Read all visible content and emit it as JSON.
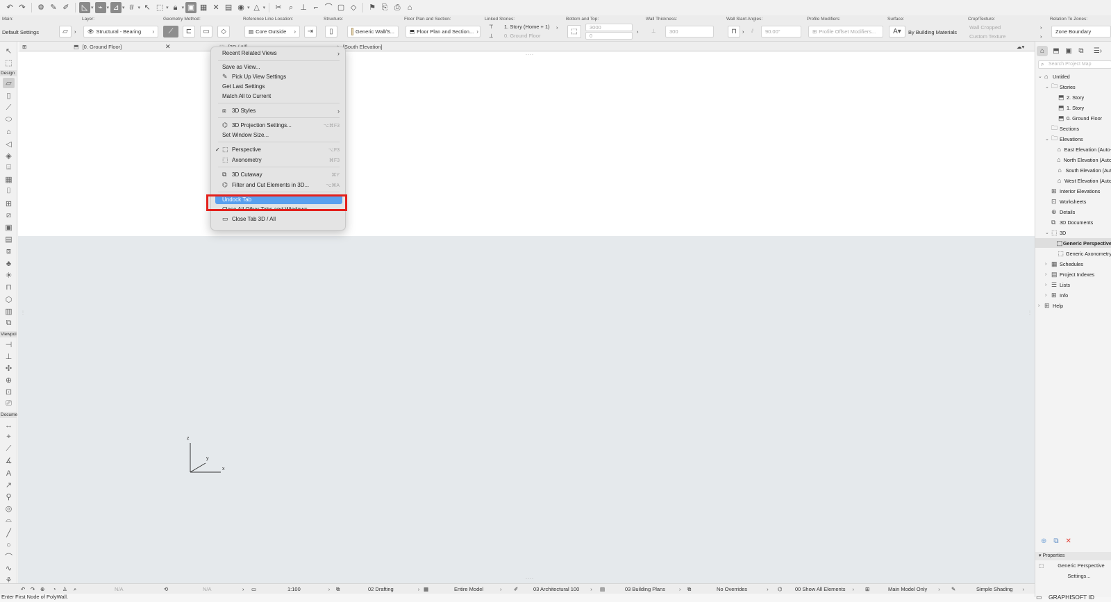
{
  "toolbar": {
    "icons": [
      "undo-icon",
      "redo-icon",
      "pet-palette-icon",
      "pick-up-icon",
      "inject-icon",
      "geometry-icon",
      "snap-icon",
      "guide-icon",
      "grid-snap-icon",
      "select-icon",
      "select-frame-icon",
      "lock-icon",
      "group-icon",
      "suspend-group-icon",
      "trace-icon",
      "elevation-icon",
      "view-icon",
      "layer-icon",
      "split-icon",
      "adjust-icon",
      "intersect-icon",
      "trim-icon",
      "fillet-icon",
      "offset-icon",
      "explode-icon",
      "flag-icon",
      "teamwork-icon",
      "receive-icon",
      "send-icon"
    ]
  },
  "infobox": {
    "main_title": "Main:",
    "main_value": "Default Settings",
    "layer_title": "Layer:",
    "layer_value": "Structural - Bearing",
    "geometry_title": "Geometry Method:",
    "refline_title": "Reference Line Location:",
    "refline_value": "Core Outside",
    "structure_title": "Structure:",
    "structure_value": "Generic Wall/S...",
    "floorplan_title": "Floor Plan and Section:",
    "floorplan_value": "Floor Plan and Section...",
    "linked_title": "Linked Stories:",
    "linked_top": "1. Story (Home + 1)",
    "linked_bottom": "0. Ground Floor",
    "bottomtop_title": "Bottom and Top:",
    "bottomtop_top": "3000",
    "bottomtop_bottom": "0",
    "thickness_title": "Wall Thickness:",
    "thickness_value": "300",
    "slant_title": "Wall Slant Angles:",
    "slant_value": "90.00°",
    "profile_title": "Profile Modifiers:",
    "profile_value": "Profile Offset Modifiers...",
    "surface_title": "Surface:",
    "surface_value": "By Building Materials",
    "crop_title": "Crop/Texture:",
    "crop_top": "Wall Cropped",
    "crop_bottom": "Custom Texture",
    "zones_title": "Relation To Zones:",
    "zones_value": "Zone Boundary"
  },
  "tabs": [
    {
      "label": "[0. Ground Floor]",
      "icon": "floor-plan-icon"
    },
    {
      "label": "[3D / All]",
      "icon": "3d-icon"
    },
    {
      "label": "[South Elevation]",
      "icon": "elevation-icon"
    }
  ],
  "toolbox": {
    "design_label": "Design",
    "viewpoint_label": "Viewpoi",
    "document_label": "Docume"
  },
  "context_menu": {
    "items": [
      {
        "label": "Recent Related Views",
        "submenu": true
      },
      {
        "label": "Save as View..."
      },
      {
        "label": "Pick Up View Settings",
        "icon": "eyedropper-icon"
      },
      {
        "label": "Get Last Settings"
      },
      {
        "label": "Match All to Current"
      },
      {
        "label": "3D Styles",
        "icon": "3d-styles-icon",
        "submenu": true
      },
      {
        "label": "3D Projection Settings...",
        "icon": "projection-icon",
        "shortcut": "⌥⌘F3"
      },
      {
        "label": "Set Window Size..."
      },
      {
        "label": "Perspective",
        "icon": "perspective-icon",
        "shortcut": "⌥F3",
        "checked": true
      },
      {
        "label": "Axonometry",
        "icon": "axonometry-icon",
        "shortcut": "⌘F3"
      },
      {
        "label": "3D Cutaway",
        "icon": "cutaway-icon",
        "shortcut": "⌘Y"
      },
      {
        "label": "Filter and Cut Elements in 3D...",
        "icon": "filter-cut-icon",
        "shortcut": "⌥⌘A"
      },
      {
        "label": "Undock Tab",
        "highlighted": true
      },
      {
        "label": "Close All Other Tabs and Windows"
      },
      {
        "label": "Close Tab 3D / All",
        "icon": "close-tab-icon"
      }
    ]
  },
  "canvas": {
    "axis_x": "x",
    "axis_y": "y",
    "axis_z": "z"
  },
  "navigator": {
    "search_placeholder": "Search Project Map",
    "tree": [
      {
        "label": "Untitled",
        "level": 0,
        "expanded": true,
        "icon": "project-icon"
      },
      {
        "label": "Stories",
        "level": 1,
        "expanded": true,
        "icon": "folder-icon"
      },
      {
        "label": "2. Story",
        "level": 2,
        "icon": "story-icon"
      },
      {
        "label": "1. Story",
        "level": 2,
        "icon": "story-icon"
      },
      {
        "label": "0. Ground Floor",
        "level": 2,
        "icon": "story-icon"
      },
      {
        "label": "Sections",
        "level": 1,
        "icon": "folder-icon"
      },
      {
        "label": "Elevations",
        "level": 1,
        "expanded": true,
        "icon": "folder-icon"
      },
      {
        "label": "East Elevation (Auto-",
        "level": 2,
        "icon": "elevation-icon"
      },
      {
        "label": "North Elevation (Auto",
        "level": 2,
        "icon": "elevation-icon"
      },
      {
        "label": "South Elevation (Aut",
        "level": 2,
        "icon": "elevation-icon"
      },
      {
        "label": "West Elevation (Auto",
        "level": 2,
        "icon": "elevation-icon"
      },
      {
        "label": "Interior Elevations",
        "level": 1,
        "icon": "interior-elevation-icon"
      },
      {
        "label": "Worksheets",
        "level": 1,
        "icon": "worksheet-icon"
      },
      {
        "label": "Details",
        "level": 1,
        "icon": "detail-icon"
      },
      {
        "label": "3D Documents",
        "level": 1,
        "icon": "3d-document-icon"
      },
      {
        "label": "3D",
        "level": 1,
        "expanded": true,
        "icon": "3d-icon"
      },
      {
        "label": "Generic Perspective",
        "level": 2,
        "icon": "perspective-icon",
        "selected": true
      },
      {
        "label": "Generic Axonometry",
        "level": 2,
        "icon": "axonometry-icon"
      },
      {
        "label": "Schedules",
        "level": 1,
        "collapsed": true,
        "icon": "schedule-icon"
      },
      {
        "label": "Project Indexes",
        "level": 1,
        "collapsed": true,
        "icon": "index-icon"
      },
      {
        "label": "Lists",
        "level": 1,
        "collapsed": true,
        "icon": "list-icon"
      },
      {
        "label": "Info",
        "level": 1,
        "collapsed": true,
        "icon": "info-icon"
      },
      {
        "label": "Help",
        "level": 0,
        "collapsed": true,
        "icon": "help-icon"
      }
    ],
    "properties_label": "Properties",
    "properties_view": "Generic Perspective",
    "settings_label": "Settings..."
  },
  "statusbar": {
    "na1": "N/A",
    "na2": "N/A",
    "scale": "1:100",
    "layer_combo": "02 Drafting",
    "model": "Entire Model",
    "pen_set": "03 Architectural 100",
    "model_view": "03 Building Plans",
    "overrides": "No Overrides",
    "renovation": "00 Show All Elements",
    "structural": "Main Model Only",
    "shading": "Simple Shading"
  },
  "prompt": "Enter First Node of PolyWall.",
  "brand": "GRAPHISOFT ID",
  "colors": {
    "highlight": "#5aa0ee",
    "callout": "#e3201b"
  }
}
